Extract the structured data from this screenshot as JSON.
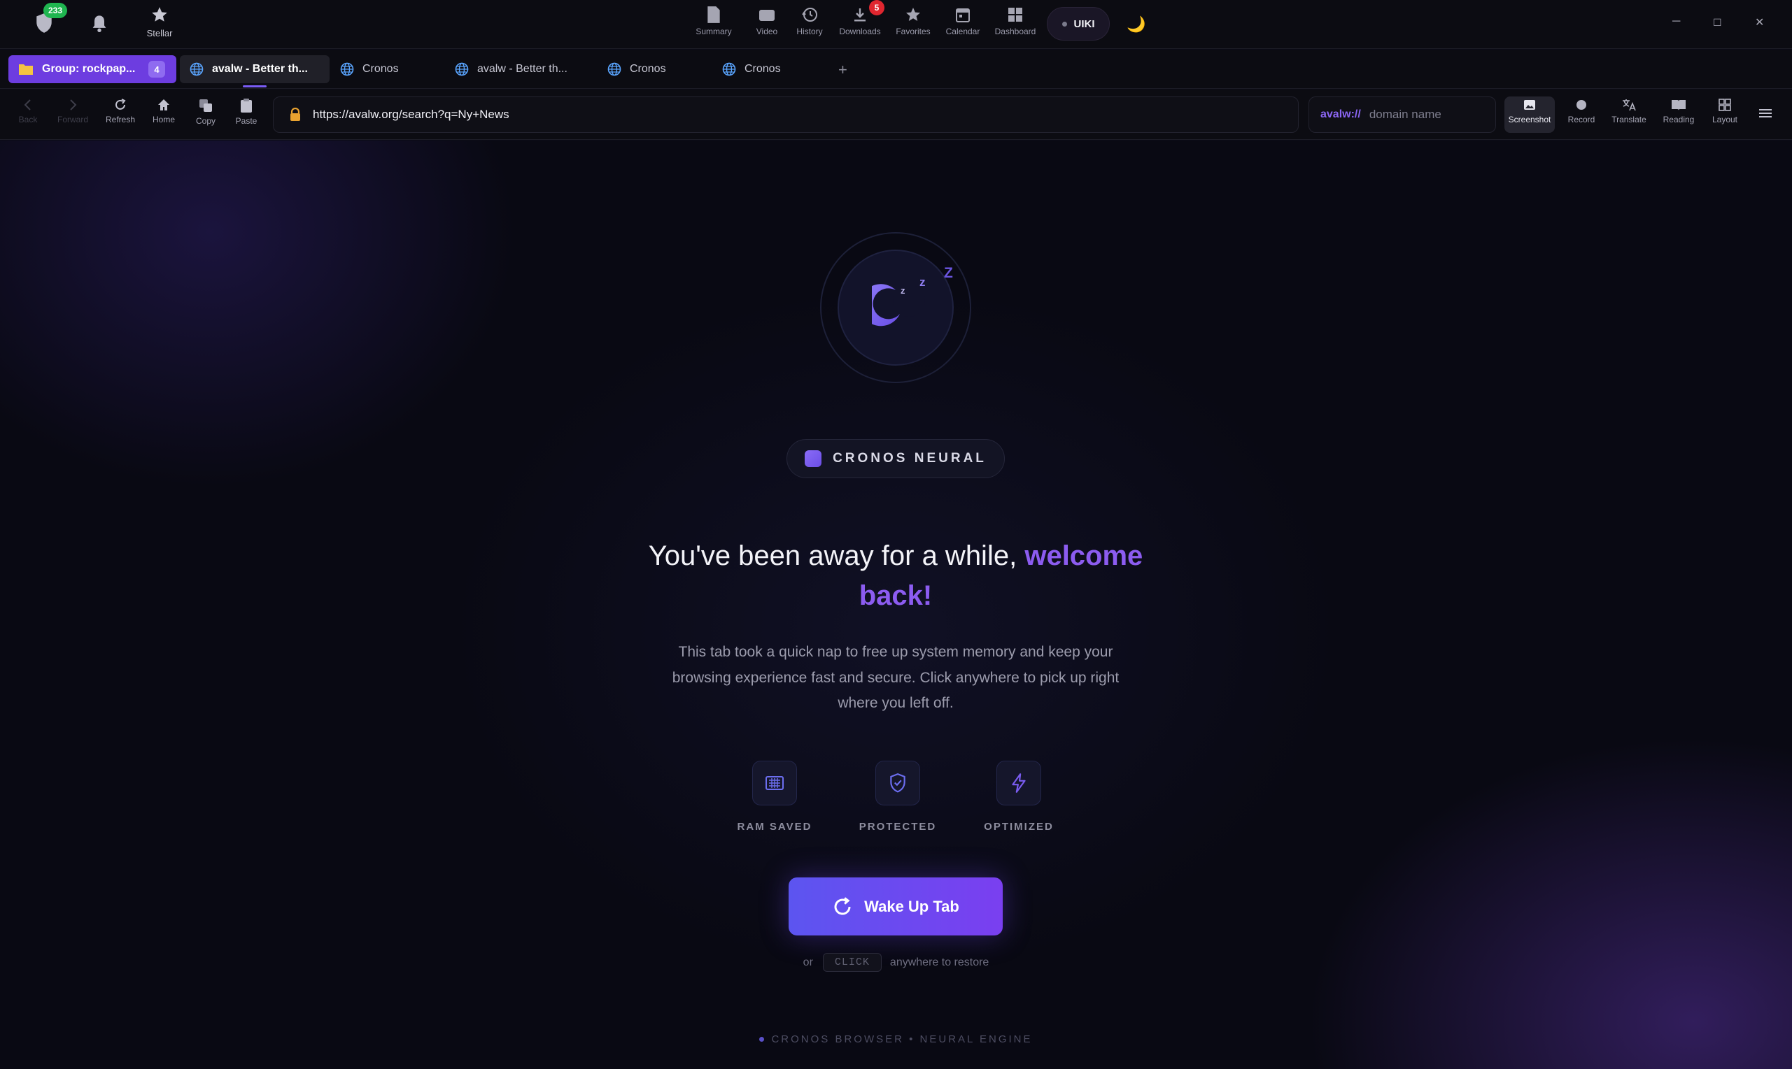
{
  "topbar": {
    "shield_count": "233",
    "stellar_label": "Stellar",
    "center_items": [
      {
        "label": "Summary",
        "icon": "document-icon"
      },
      {
        "label": "Video",
        "icon": "video-icon"
      },
      {
        "label": "History",
        "icon": "history-icon"
      },
      {
        "label": "Downloads",
        "icon": "download-icon",
        "badge": "5"
      },
      {
        "label": "Favorites",
        "icon": "star-icon"
      },
      {
        "label": "Calendar",
        "icon": "calendar-icon"
      },
      {
        "label": "Dashboard",
        "icon": "grid-icon"
      }
    ],
    "profile_label": "UIKI",
    "theme_icon": "🌙",
    "window_controls": {
      "minimize": "─",
      "maximize": "☐",
      "close": "✕"
    },
    "badge_color": "#e0262f",
    "shield_badge_color": "#1fb54f"
  },
  "tabs": {
    "group_label": "Group: rockpap...",
    "group_count": "4",
    "items": [
      {
        "label": "avalw - Better th...",
        "active": true
      },
      {
        "label": "Cronos"
      },
      {
        "label": "avalw - Better th..."
      },
      {
        "label": "Cronos"
      },
      {
        "label": "Cronos"
      }
    ],
    "new_tab": "+"
  },
  "nav": {
    "back": "Back",
    "forward": "Forward",
    "refresh": "Refresh",
    "home": "Home",
    "copy": "Copy",
    "paste": "Paste",
    "url": "https://avalw.org/search?q=Ny+News",
    "domain_scheme": "avalw://",
    "domain_placeholder": "domain name",
    "right_tools": [
      "Screenshot",
      "Record",
      "Translate",
      "Reading",
      "Layout"
    ]
  },
  "sleep_page": {
    "sleep_letters": [
      "z",
      "z",
      "Z"
    ],
    "brand": "CRONOS NEURAL",
    "headline_main": "You've been away for a while,",
    "headline_accent": "welcome back!",
    "description": "This tab took a quick nap to free up system memory and keep your browsing experience fast and secure. Click anywhere to pick up right where you left off.",
    "features": [
      "RAM SAVED",
      "PROTECTED",
      "OPTIMIZED"
    ],
    "wake_button": "Wake Up Tab",
    "hint_prefix": "or",
    "hint_key": "CLICK",
    "hint_suffix": "anywhere to restore",
    "footer": "CRONOS BROWSER • NEURAL ENGINE",
    "accent_color": "#8c5cf0"
  }
}
